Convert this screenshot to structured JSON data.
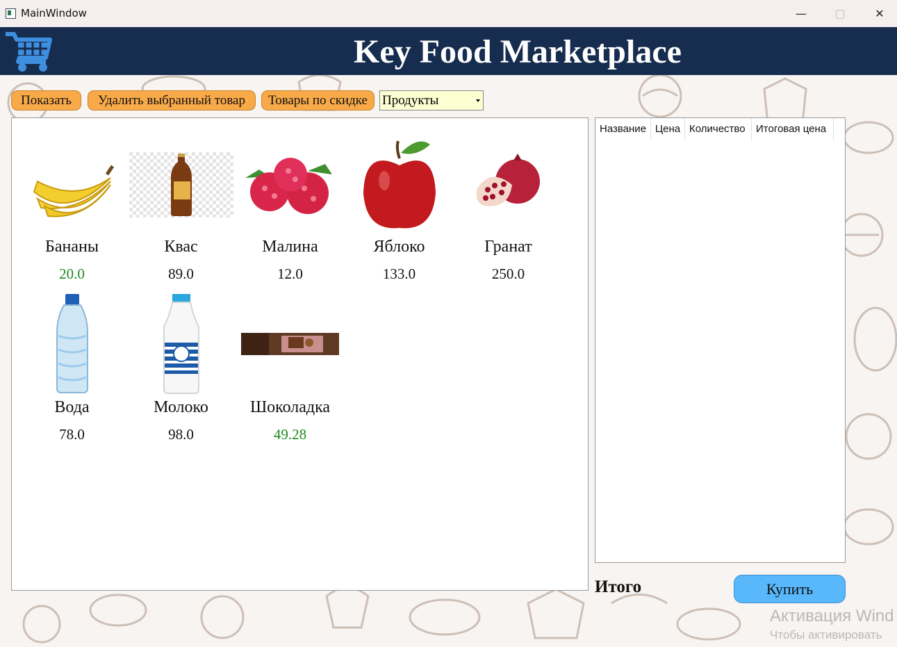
{
  "window": {
    "title": "MainWindow"
  },
  "header": {
    "brand": "Key Food Marketplace",
    "logo_icon": "shopping-cart-icon"
  },
  "toolbar": {
    "show_label": "Показать",
    "delete_label": "Удалить выбранный товар",
    "discount_label": "Товары по скидке",
    "category_selected": "Продукты"
  },
  "products": [
    {
      "name": "Бананы",
      "price": "20.0",
      "discounted": true,
      "icon": "banana-image"
    },
    {
      "name": "Квас",
      "price": "89.0",
      "discounted": false,
      "icon": "kvass-bottle-image"
    },
    {
      "name": "Малина",
      "price": "12.0",
      "discounted": false,
      "icon": "raspberry-image"
    },
    {
      "name": "Яблоко",
      "price": "133.0",
      "discounted": false,
      "icon": "apple-image"
    },
    {
      "name": "Гранат",
      "price": "250.0",
      "discounted": false,
      "icon": "pomegranate-image"
    },
    {
      "name": "Вода",
      "price": "78.0",
      "discounted": false,
      "icon": "water-bottle-image"
    },
    {
      "name": "Молоко",
      "price": "98.0",
      "discounted": false,
      "icon": "milk-bottle-image"
    },
    {
      "name": "Шоколадка",
      "price": "49.28",
      "discounted": true,
      "icon": "chocolate-bar-image"
    }
  ],
  "cart": {
    "columns": [
      "Название",
      "Цена",
      "Количество",
      "Итоговая цена"
    ]
  },
  "footer": {
    "total_label": "Итого",
    "buy_label": "Купить"
  },
  "watermark": {
    "line1": "Активация Wind",
    "line2": "Чтобы активировать"
  },
  "colors": {
    "header": "#172d4f",
    "button": "#f9aa48",
    "buy": "#58b8fb",
    "discount_price": "#1e8a1e"
  }
}
